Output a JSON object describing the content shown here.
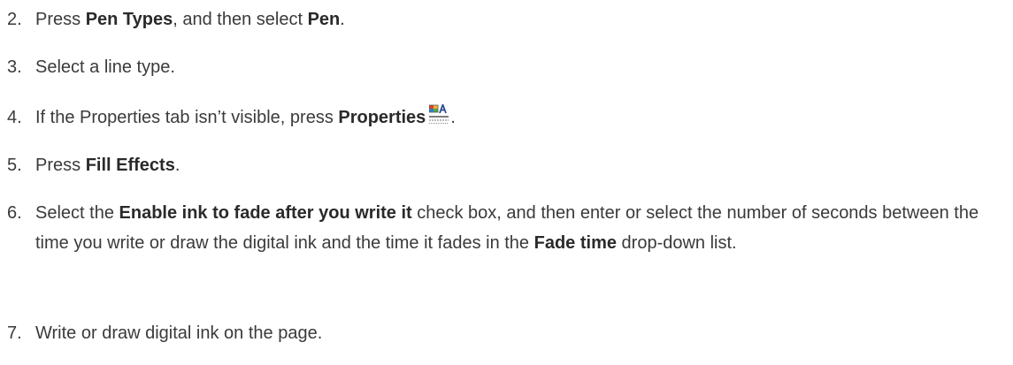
{
  "steps": [
    {
      "num": "2.",
      "parts": [
        "Press ",
        "Pen Types",
        ", and then select ",
        "Pen",
        "."
      ]
    },
    {
      "num": "3.",
      "text": "Select a line type."
    },
    {
      "num": "4.",
      "parts": [
        "If the Properties tab isn’t visible, press ",
        "Properties",
        "."
      ],
      "icon": "properties-icon"
    },
    {
      "num": "5.",
      "parts": [
        "Press ",
        "Fill Effects",
        "."
      ]
    },
    {
      "num": "6.",
      "parts": [
        "Select the ",
        "Enable ink to fade after you write it",
        " check box, and then enter or select the number of seconds between the time you write or draw the digital ink and the time it fades in the ",
        "Fade time",
        " drop-down list."
      ]
    },
    {
      "num": "7.",
      "text": "Write or draw digital ink on the page."
    }
  ]
}
